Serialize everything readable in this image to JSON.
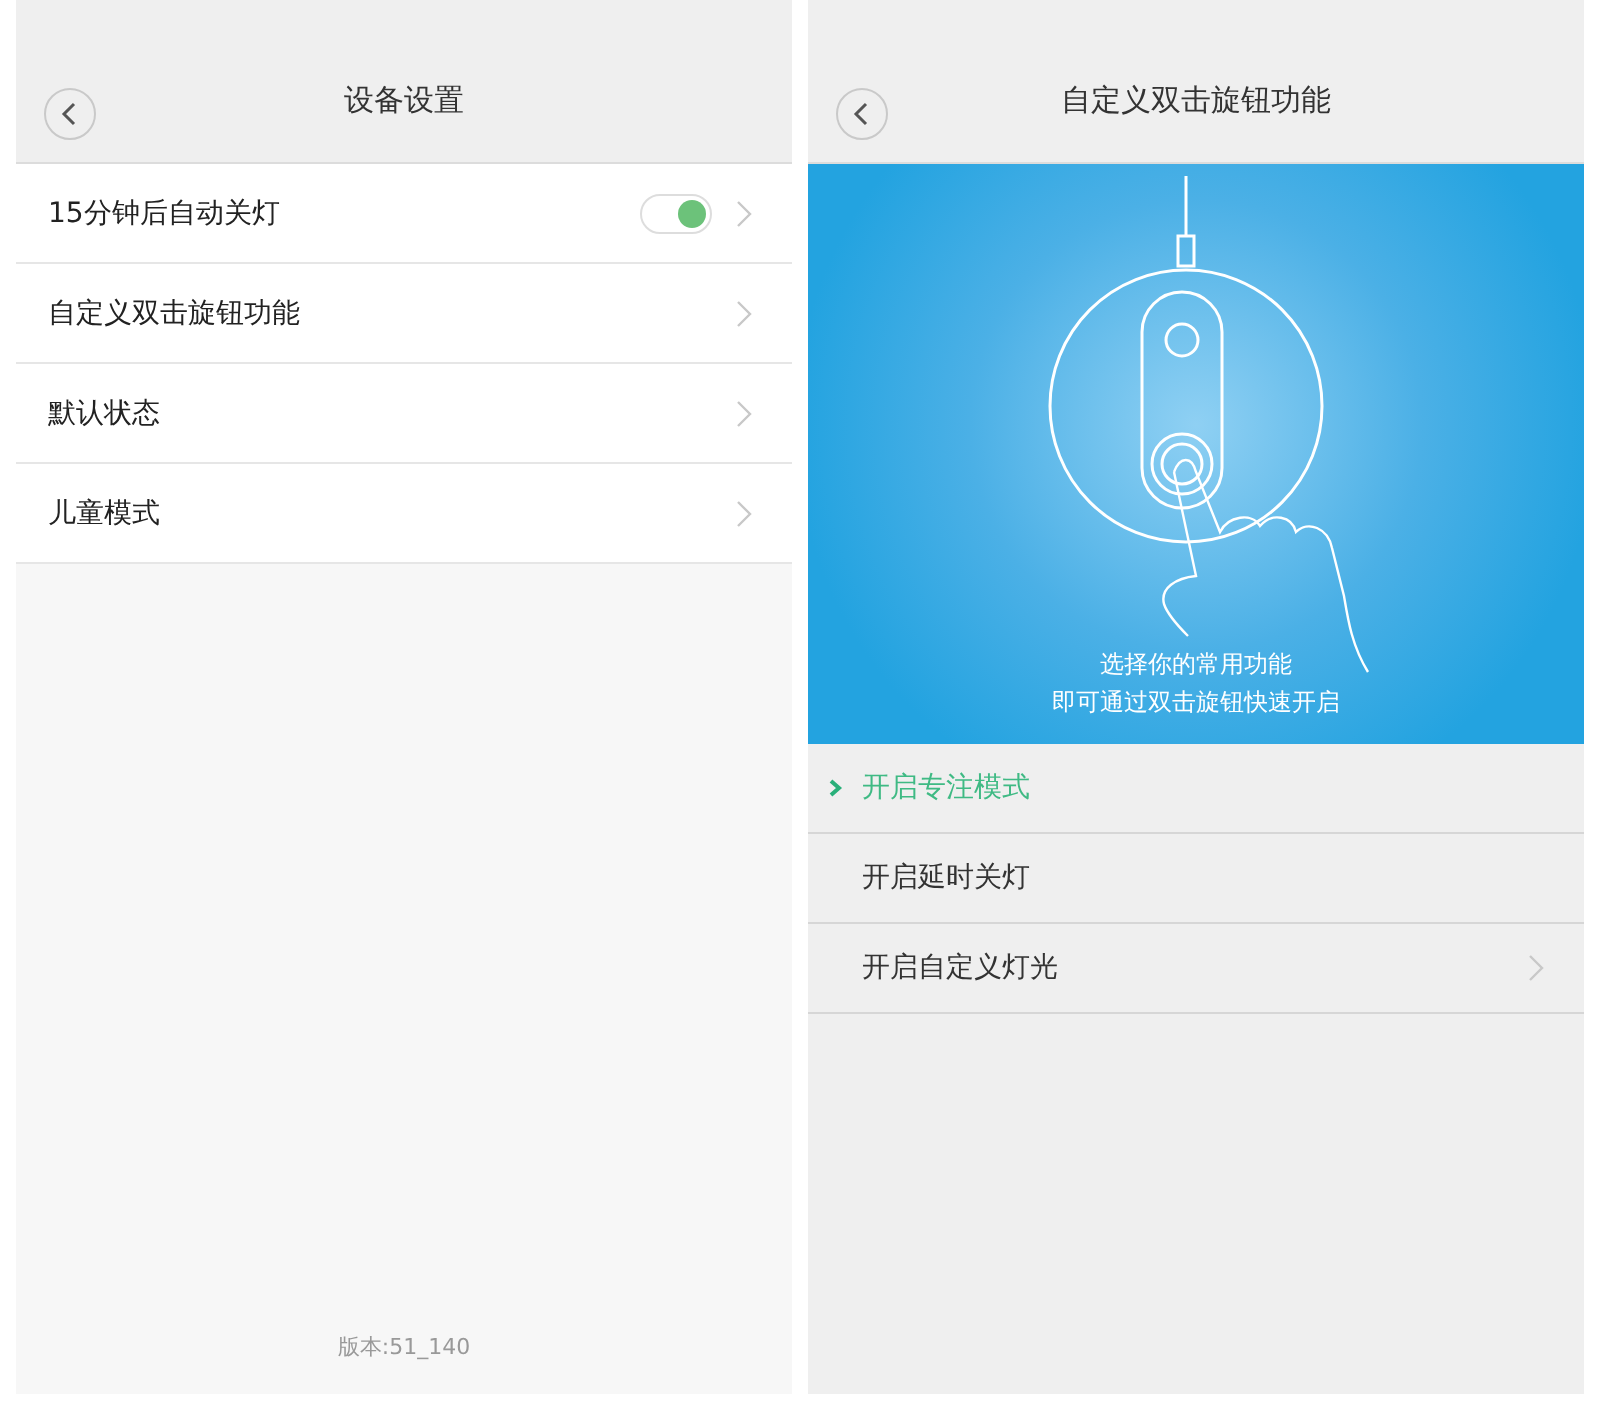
{
  "left_screen": {
    "title": "设备设置",
    "settings": [
      {
        "label": "15分钟后自动关灯",
        "kind": "toggle",
        "on": true
      },
      {
        "label": "自定义双击旋钮功能",
        "kind": "link"
      },
      {
        "label": "默认状态",
        "kind": "link"
      },
      {
        "label": "儿童模式",
        "kind": "link"
      }
    ],
    "version": "版本:51_140"
  },
  "right_screen": {
    "title": "自定义双击旋钮功能",
    "banner_caption": [
      "选择你的常用功能",
      "即可通过双击旋钮快速开启"
    ],
    "options": [
      {
        "label": "开启专注模式",
        "kind": "plain",
        "selected": true
      },
      {
        "label": "开启延时关灯",
        "kind": "plain",
        "selected": false
      },
      {
        "label": "开启自定义灯光",
        "kind": "submenu",
        "selected": false
      }
    ]
  }
}
